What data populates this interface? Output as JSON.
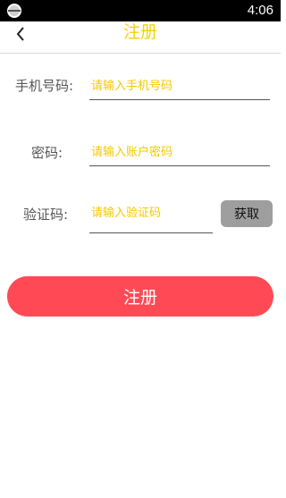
{
  "status_bar": {
    "time": "4:06",
    "app_icon": "app-icon"
  },
  "app_bar": {
    "title": "注册",
    "back_icon": "chevron-left-icon"
  },
  "form": {
    "phone": {
      "label": "手机号码:",
      "placeholder": "请输入手机号码",
      "value": ""
    },
    "password": {
      "label": "密码:",
      "placeholder": "请输入账户密码",
      "value": ""
    },
    "code": {
      "label": "验证码:",
      "placeholder": "请输入验证码",
      "value": "",
      "get_button": "获取"
    }
  },
  "register_button": "注册",
  "colors": {
    "accent_yellow": "#f5d400",
    "register_red": "#ff4a55",
    "get_button_gray": "#9e9e9e",
    "status_bar": "#000000"
  }
}
